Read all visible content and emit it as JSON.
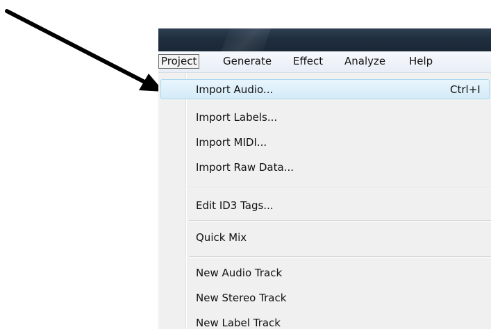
{
  "menubar": {
    "items": [
      {
        "label": "Project",
        "active": true
      },
      {
        "label": "Generate"
      },
      {
        "label": "Effect"
      },
      {
        "label": "Analyze"
      },
      {
        "label": "Help"
      }
    ]
  },
  "dropdown": {
    "items": [
      {
        "label": "Import Audio...",
        "shortcut": "Ctrl+I",
        "highlighted": true
      },
      {
        "label": "Import Labels..."
      },
      {
        "label": "Import MIDI..."
      },
      {
        "label": "Import Raw Data..."
      },
      {
        "label": "Edit ID3 Tags..."
      },
      {
        "label": "Quick Mix"
      },
      {
        "label": "New Audio Track"
      },
      {
        "label": "New Stereo Track"
      },
      {
        "label": "New Label Track"
      }
    ]
  },
  "annotation": {
    "arrow_color": "#000000"
  },
  "colors": {
    "title_bar": "#1f2e3e",
    "menu_bg": "#f0f0f0",
    "highlight": "#d4ebf8"
  }
}
